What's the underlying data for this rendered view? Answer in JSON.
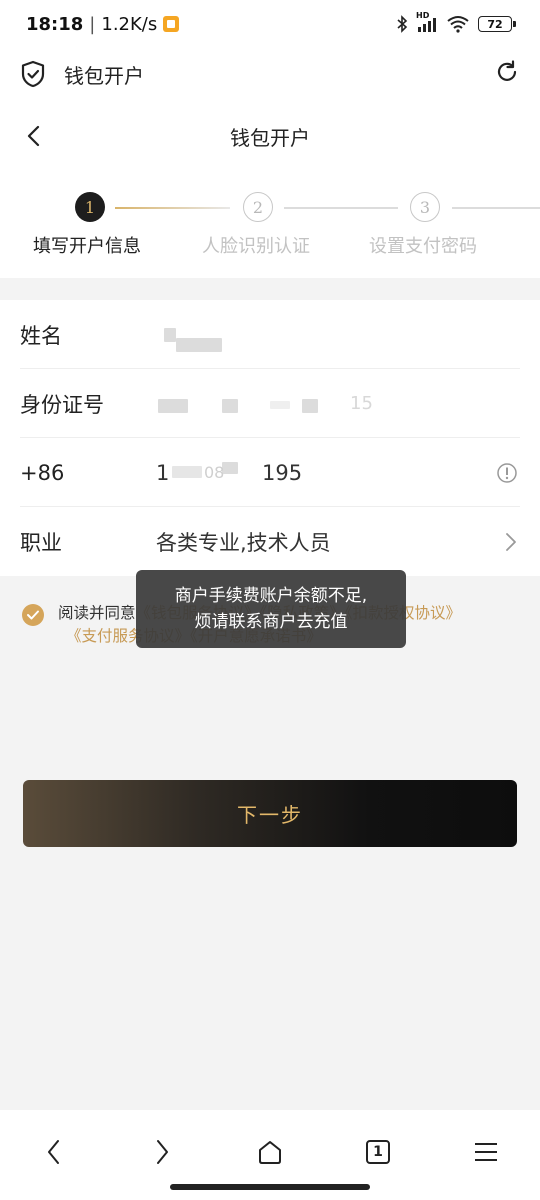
{
  "status_bar": {
    "time": "18:18",
    "speed": "1.2K/s",
    "network_label": "HD",
    "battery": "72"
  },
  "app_bar": {
    "title": "钱包开户"
  },
  "header": {
    "title": "钱包开户"
  },
  "steps": [
    {
      "number": "1",
      "label": "填写开户信息",
      "active": true
    },
    {
      "number": "2",
      "label": "人脸识别认证",
      "active": false
    },
    {
      "number": "3",
      "label": "设置支付密码",
      "active": false
    }
  ],
  "form": {
    "name": {
      "label": "姓名",
      "value": ""
    },
    "id_number": {
      "label": "身份证号",
      "value": "15"
    },
    "phone": {
      "label": "+86",
      "value_start": "1",
      "value_mid": "08",
      "value_end": "195"
    },
    "occupation": {
      "label": "职业",
      "value": "各类专业,技术人员"
    }
  },
  "agreement": {
    "prefix": "阅读并同意",
    "line1_links": "《钱包服务协议》《隐私政策》《扣款授权协议》",
    "line2_links": "《支付服务协议》《开户意愿承诺书》"
  },
  "toast": {
    "line1": "商户手续费账户余额不足,",
    "line2": "烦请联系商户去充值"
  },
  "next_button": {
    "label": "下一步"
  },
  "bottom_nav": {
    "tab_count": "1"
  },
  "colors": {
    "accent_gold": "#d5a55a",
    "link_gold": "#c79a55",
    "active_step": "#1d1d1d"
  }
}
